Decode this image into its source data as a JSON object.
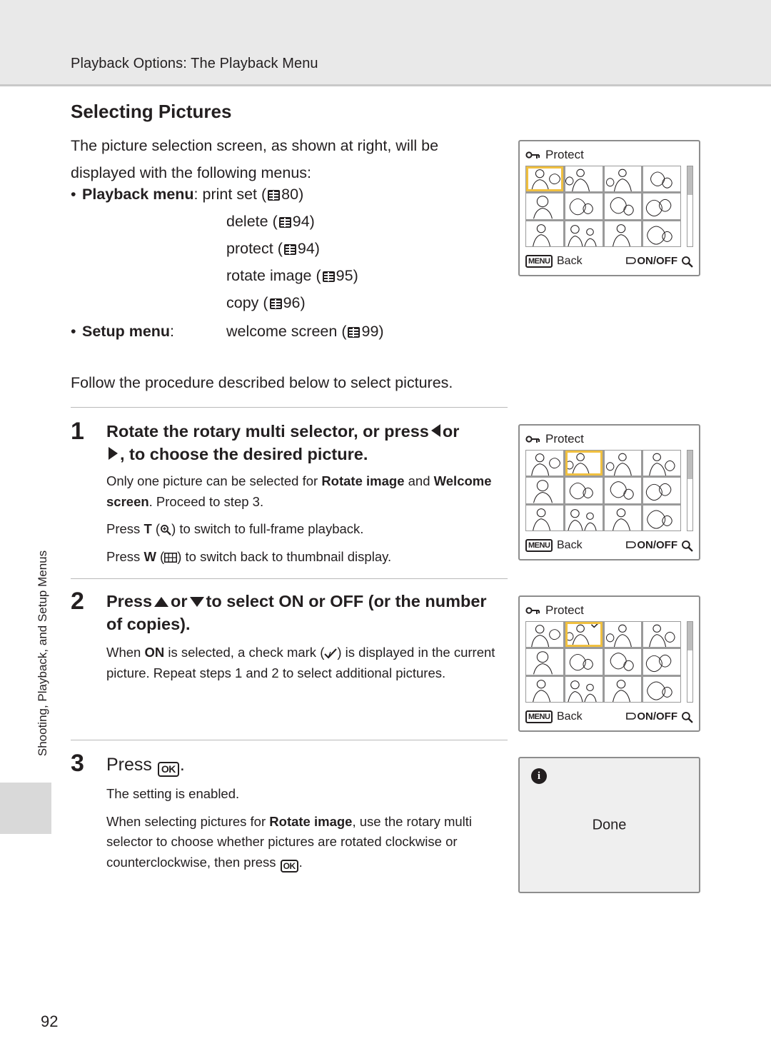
{
  "header": {
    "running_head": "Playback Options: The Playback Menu"
  },
  "page_number": "92",
  "side_tab": {
    "label": "Shooting, Playback, and Setup Menus"
  },
  "section": {
    "title": "Selecting Pictures",
    "intro": "The picture selection screen, as shown at right, will be displayed with the following menus:",
    "follow": "Follow the procedure described below to select pictures."
  },
  "menu_list": [
    {
      "label": "Playback menu",
      "sep": ":",
      "items": [
        {
          "name": "print set",
          "ref": "80"
        },
        {
          "name": "delete",
          "ref": "94"
        },
        {
          "name": "protect",
          "ref": "94"
        },
        {
          "name": "rotate image",
          "ref": "95"
        },
        {
          "name": "copy",
          "ref": "96"
        }
      ]
    },
    {
      "label": "Setup menu",
      "sep": ":",
      "items": [
        {
          "name": "welcome screen",
          "ref": "99"
        }
      ]
    }
  ],
  "steps": [
    {
      "num": "1",
      "title_a": "Rotate the rotary multi selector, or press",
      "title_b": "or",
      "title_c": ", to choose the desired picture.",
      "body": [
        {
          "pre": "Only one picture can be selected for ",
          "bold1": "Rotate image",
          "mid": " and ",
          "bold2": "Welcome screen",
          "post": ". Proceed to step 3."
        },
        {
          "pre": "Press ",
          "bold1": "T",
          "mid": " (",
          "post": ") to switch to full-frame playback."
        },
        {
          "pre": "Press ",
          "bold1": "W",
          "mid": " (",
          "post": ") to switch back to thumbnail display."
        }
      ]
    },
    {
      "num": "2",
      "title_a": "Press",
      "title_or": "or",
      "title_b": "to select",
      "title_on": "ON",
      "title_or2": "or",
      "title_off": "OFF",
      "title_c": "(or the number of copies).",
      "body": [
        {
          "pre": "When ",
          "bold1": "ON",
          "mid": " is selected, a check mark (",
          "post": ") is displayed in the current picture. Repeat steps 1 and 2 to select additional pictures."
        }
      ]
    },
    {
      "num": "3",
      "title_a": "Press",
      "title_c": ".",
      "body": [
        {
          "text": "The setting is enabled."
        },
        {
          "pre": "When selecting pictures for ",
          "bold1": "Rotate image",
          "post": ", use the rotary multi selector to choose whether pictures are rotated clockwise or counterclockwise, then press"
        }
      ]
    }
  ],
  "lcd_screens": [
    {
      "id": "screen-1",
      "title": "Protect",
      "back_label": "Back",
      "menu_label": "MENU",
      "onoff_label": "ON/OFF",
      "selected_cell": 0
    },
    {
      "id": "screen-2",
      "title": "Protect",
      "back_label": "Back",
      "menu_label": "MENU",
      "onoff_label": "ON/OFF",
      "selected_cell": 1
    },
    {
      "id": "screen-3",
      "title": "Protect",
      "back_label": "Back",
      "menu_label": "MENU",
      "onoff_label": "ON/OFF",
      "selected_cell": 1
    },
    {
      "id": "screen-4",
      "done_label": "Done",
      "info_glyph": "i"
    }
  ],
  "colors": {
    "header_band": "#e9e9e9",
    "text": "#231f20",
    "lcd_border": "#8d8d8d",
    "selection": "#f0c040"
  }
}
